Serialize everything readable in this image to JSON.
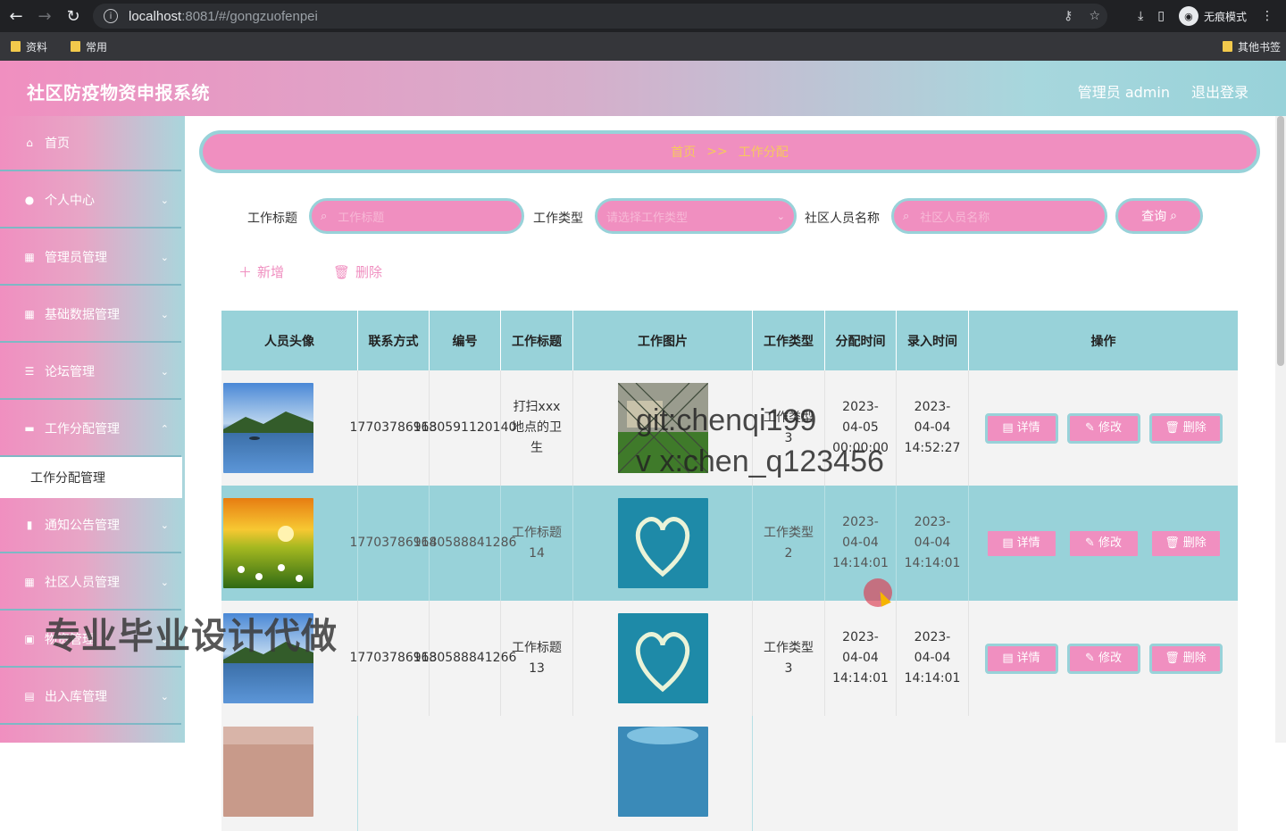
{
  "browser": {
    "url_host": "localhost",
    "url_rest": ":8081/#/gongzuofenpei",
    "incognito_label": "无痕模式",
    "bookmarks": [
      "资料",
      "常用"
    ],
    "other_bookmarks": "其他书签"
  },
  "header": {
    "title": "社区防疫物资申报系统",
    "user": "管理员 admin",
    "logout": "退出登录"
  },
  "sidebar": {
    "items": [
      {
        "label": "首页",
        "icon": "home-icon",
        "glyph": "⌂"
      },
      {
        "label": "个人中心",
        "icon": "user-icon",
        "glyph": "●"
      },
      {
        "label": "管理员管理",
        "icon": "grid-icon",
        "glyph": "▦"
      },
      {
        "label": "基础数据管理",
        "icon": "grid-icon",
        "glyph": "▦"
      },
      {
        "label": "论坛管理",
        "icon": "sliders-icon",
        "glyph": "☰"
      },
      {
        "label": "工作分配管理",
        "icon": "monitor-icon",
        "glyph": "▬"
      },
      {
        "label": "通知公告管理",
        "icon": "chart-icon",
        "glyph": "▮"
      },
      {
        "label": "社区人员管理",
        "icon": "grid-icon",
        "glyph": "▦"
      },
      {
        "label": "物资管理",
        "icon": "box-icon",
        "glyph": "▣"
      },
      {
        "label": "出入库管理",
        "icon": "clipboard-icon",
        "glyph": "▤"
      }
    ],
    "active_sub": "工作分配管理"
  },
  "breadcrumb": {
    "home": "首页",
    "sep": ">>",
    "current": "工作分配"
  },
  "search": {
    "title_label": "工作标题",
    "title_placeholder": "工作标题",
    "type_label": "工作类型",
    "type_placeholder": "请选择工作类型",
    "name_label": "社区人员名称",
    "name_placeholder": "社区人员名称",
    "query_button": "查询"
  },
  "actions": {
    "add": "新增",
    "delete": "删除"
  },
  "table": {
    "headers": [
      "人员头像",
      "联系方式",
      "编号",
      "工作标题",
      "工作图片",
      "工作类型",
      "分配时间",
      "录入时间",
      "操作"
    ],
    "rows": [
      {
        "phone": "17703786913",
        "code": "1680591120140",
        "title": "打扫xxx地点的卫生",
        "type": "工作类型3",
        "assign_time": "2023-04-05 00:00:00",
        "entry_time": "2023-04-04 14:52:27"
      },
      {
        "phone": "17703786914",
        "code": "1680588841286",
        "title": "工作标题14",
        "type": "工作类型2",
        "assign_time": "2023-04-04 14:14:01",
        "entry_time": "2023-04-04 14:14:01"
      },
      {
        "phone": "17703786913",
        "code": "1680588841266",
        "title": "工作标题13",
        "type": "工作类型3",
        "assign_time": "2023-04-04 14:14:01",
        "entry_time": "2023-04-04 14:14:01"
      }
    ],
    "ops": {
      "detail": "详情",
      "edit": "修改",
      "delete": "删除"
    }
  },
  "overlays": {
    "watermark1": "git:chenqi199",
    "watermark2": "v x:chen_q123456",
    "watermark3": "专业毕业设计代做"
  }
}
